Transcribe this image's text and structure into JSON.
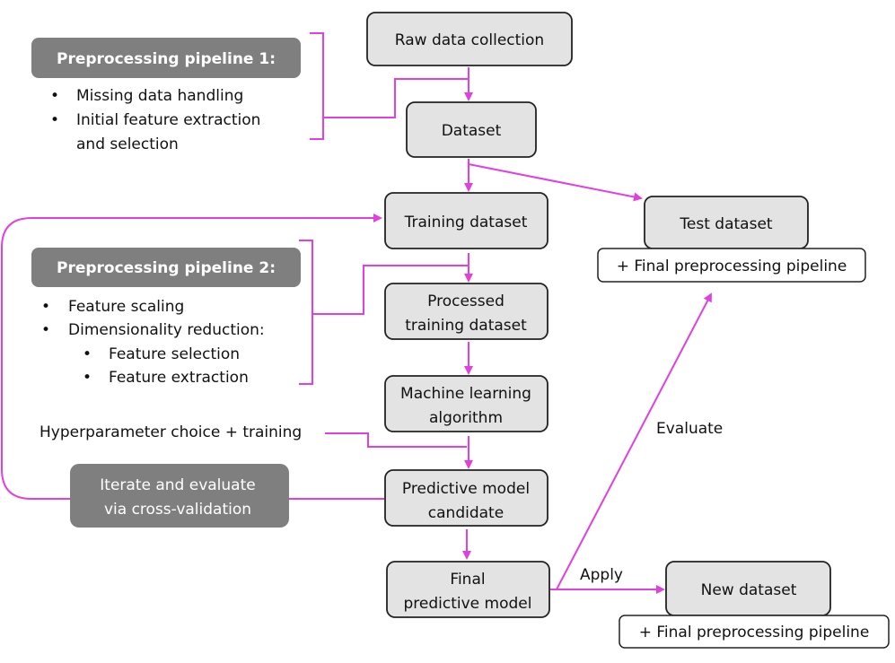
{
  "colors": {
    "connector": "#e040e0",
    "box_fill": "#e3e3e3",
    "header_fill": "#7f7f7f"
  },
  "nodes": {
    "raw": "Raw data collection",
    "dataset": "Dataset",
    "training": "Training dataset",
    "test": "Test dataset",
    "test_sub": "+ Final preprocessing pipeline",
    "processed": [
      "Processed",
      "training dataset"
    ],
    "ml": [
      "Machine learning",
      "algorithm"
    ],
    "candidate": [
      "Predictive model",
      "candidate"
    ],
    "final": [
      "Final",
      "predictive model"
    ],
    "newds": "New dataset",
    "new_sub": "+ Final preprocessing pipeline"
  },
  "pipeline1": {
    "title": "Preprocessing  pipeline 1:",
    "items": [
      "Missing data handling",
      "Initial feature extraction",
      "and selection"
    ]
  },
  "pipeline2": {
    "title": "Preprocessing pipeline 2:",
    "items": [
      "Feature scaling",
      "Dimensionality reduction:"
    ],
    "subitems": [
      "Feature selection",
      "Feature extraction"
    ]
  },
  "hyper": "Hyperparameter choice + training",
  "iterate": [
    "Iterate and evaluate",
    "via cross-validation"
  ],
  "evaluate": "Evaluate",
  "apply": "Apply"
}
